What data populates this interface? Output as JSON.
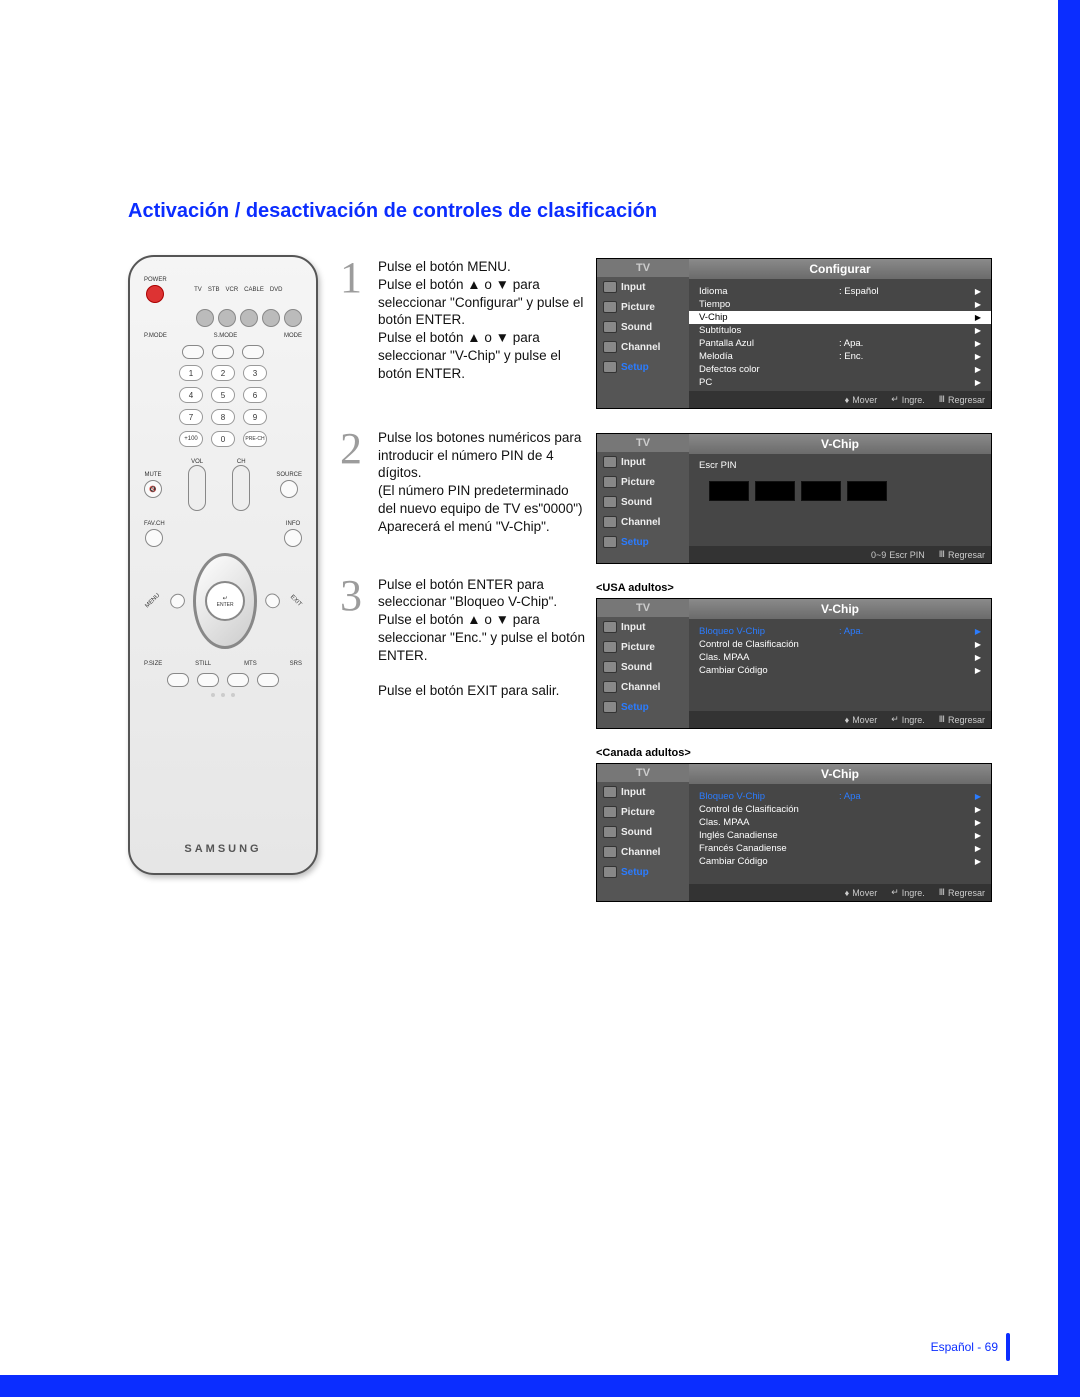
{
  "page": {
    "title": "Activación / desactivación de controles de clasificación",
    "footer_lang": "Español",
    "footer_page": "69"
  },
  "remote": {
    "brand": "SAMSUNG",
    "top_labels": [
      "POWER",
      "TV",
      "STB",
      "VCR",
      "CABLE",
      "DVD"
    ],
    "mode_row": [
      "P.MODE",
      "S.MODE",
      "MODE"
    ],
    "numbers": [
      "1",
      "2",
      "3",
      "4",
      "5",
      "6",
      "7",
      "8",
      "9"
    ],
    "bottom_numbers": [
      "+100",
      "0",
      "PRE-CH"
    ],
    "side_labels": {
      "mute": "MUTE",
      "source": "SOURCE",
      "vol": "VOL",
      "ch": "CH"
    },
    "dpad_labels": {
      "favch": "FAV.CH",
      "info": "INFO",
      "menu": "MENU",
      "exit": "EXIT",
      "enter": "ENTER",
      "enter_icon": "↵"
    },
    "foot_row": [
      "P.SIZE",
      "STILL",
      "MTS",
      "SRS"
    ]
  },
  "steps": [
    {
      "n": "1",
      "text": "Pulse el botón MENU.\nPulse el botón ▲ o ▼ para seleccionar \"Configurar\" y pulse el botón ENTER.\nPulse el botón ▲ o ▼ para seleccionar \"V-Chip\" y pulse el botón ENTER."
    },
    {
      "n": "2",
      "text": "Pulse los botones numéricos para introducir el número PIN de 4 dígitos.\n(El número PIN predeterminado del nuevo equipo de TV es\"0000\")\nAparecerá el menú \"V-Chip\"."
    },
    {
      "n": "3",
      "text": "Pulse el botón ENTER para seleccionar \"Bloqueo V-Chip\".\nPulse el botón ▲ o ▼ para seleccionar \"Enc.\" y pulse el botón ENTER.\n\nPulse el botón EXIT para salir."
    }
  ],
  "osd_tabs": [
    "Input",
    "Picture",
    "Sound",
    "Channel",
    "Setup"
  ],
  "osd_tv": "TV",
  "osd_foot": {
    "mover": "Mover",
    "ingre": "Ingre.",
    "regresar": "Regresar",
    "escrpin": "Escr PIN"
  },
  "osd1": {
    "title": "Configurar",
    "rows": [
      {
        "k": "Idioma",
        "v": ": Español"
      },
      {
        "k": "Tiempo",
        "v": ""
      },
      {
        "k": "V-Chip",
        "v": "",
        "hl": true
      },
      {
        "k": "Subtítulos",
        "v": ""
      },
      {
        "k": "Pantalla Azul",
        "v": ": Apa."
      },
      {
        "k": "Melodía",
        "v": ": Enc."
      },
      {
        "k": "Defectos color",
        "v": ""
      },
      {
        "k": "PC",
        "v": ""
      }
    ]
  },
  "osd2": {
    "title": "V-Chip",
    "label": "Escr PIN"
  },
  "osd3_label": "<USA adultos>",
  "osd3": {
    "title": "V-Chip",
    "rows": [
      {
        "k": "Bloqueo V-Chip",
        "v": ": Apa.",
        "sel": true
      },
      {
        "k": "Control de Clasificación",
        "v": ""
      },
      {
        "k": "Clas. MPAA",
        "v": ""
      },
      {
        "k": "Cambiar Código",
        "v": ""
      }
    ]
  },
  "osd4_label": "<Canada adultos>",
  "osd4": {
    "title": "V-Chip",
    "rows": [
      {
        "k": "Bloqueo V-Chip",
        "v": ": Apa",
        "sel": true
      },
      {
        "k": "Control de Clasificación",
        "v": ""
      },
      {
        "k": "Clas. MPAA",
        "v": ""
      },
      {
        "k": "Inglés Canadiense",
        "v": ""
      },
      {
        "k": "Francés Canadiense",
        "v": ""
      },
      {
        "k": "Cambiar Código",
        "v": ""
      }
    ]
  }
}
